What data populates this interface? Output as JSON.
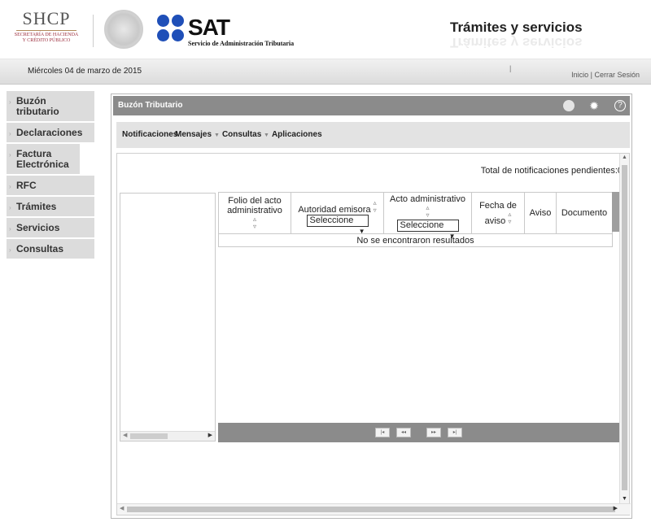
{
  "header": {
    "shcp_logo": {
      "acronym": "SHCP",
      "line1": "SECRETARÍA DE HACIENDA",
      "line2": "Y CRÉDITO PÚBLICO"
    },
    "sat_logo": {
      "acronym": "SAT",
      "subtitle": "Servicio de Administración Tributaria"
    },
    "title": "Trámites y servicios"
  },
  "datebar": {
    "date": "Miércoles 04 de marzo de 2015",
    "separator": "|",
    "inicio": "Inicio",
    "link_sep": " | ",
    "cerrar_sesion": "Cerrar Sesión"
  },
  "sidebar": {
    "items": [
      {
        "label": "Buzón tributario"
      },
      {
        "label": "Declaraciones"
      },
      {
        "label": "Factura Electrónica"
      },
      {
        "label": "RFC"
      },
      {
        "label": "Trámites"
      },
      {
        "label": "Servicios"
      },
      {
        "label": "Consultas"
      }
    ]
  },
  "panel": {
    "title": "Buzón Tributario",
    "icons": [
      "circle-icon",
      "gear-icon",
      "help-icon"
    ],
    "nav": {
      "notificaciones": "Notificaciones",
      "mensajes": "Mensajes",
      "consultas": "Consultas",
      "aplicaciones": "Aplicaciones"
    },
    "total_pending": "Total de notificaciones pendientes:0"
  },
  "grid": {
    "columns": [
      {
        "label": "Folio del acto administrativo",
        "sortable": true
      },
      {
        "label": "Autoridad emisora",
        "sortable": true,
        "filter": "Seleccione"
      },
      {
        "label": "Acto administrativo",
        "sortable": true,
        "filter": "Seleccione"
      },
      {
        "label": "Fecha de aviso",
        "sortable": true
      },
      {
        "label": "Aviso",
        "sortable": false
      },
      {
        "label": "Documento",
        "sortable": false
      }
    ],
    "empty_message": "No se encontraron resultados",
    "pager": {
      "first": "|◂",
      "prev": "◂◂",
      "next": "▸▸",
      "last": "▸|"
    }
  },
  "colors": {
    "panel_header": "#8b8b8b",
    "sidebar_bg": "#dcdcdc",
    "sat_blue": "#1f4fb8",
    "nav_bg": "#e3e3e3"
  }
}
